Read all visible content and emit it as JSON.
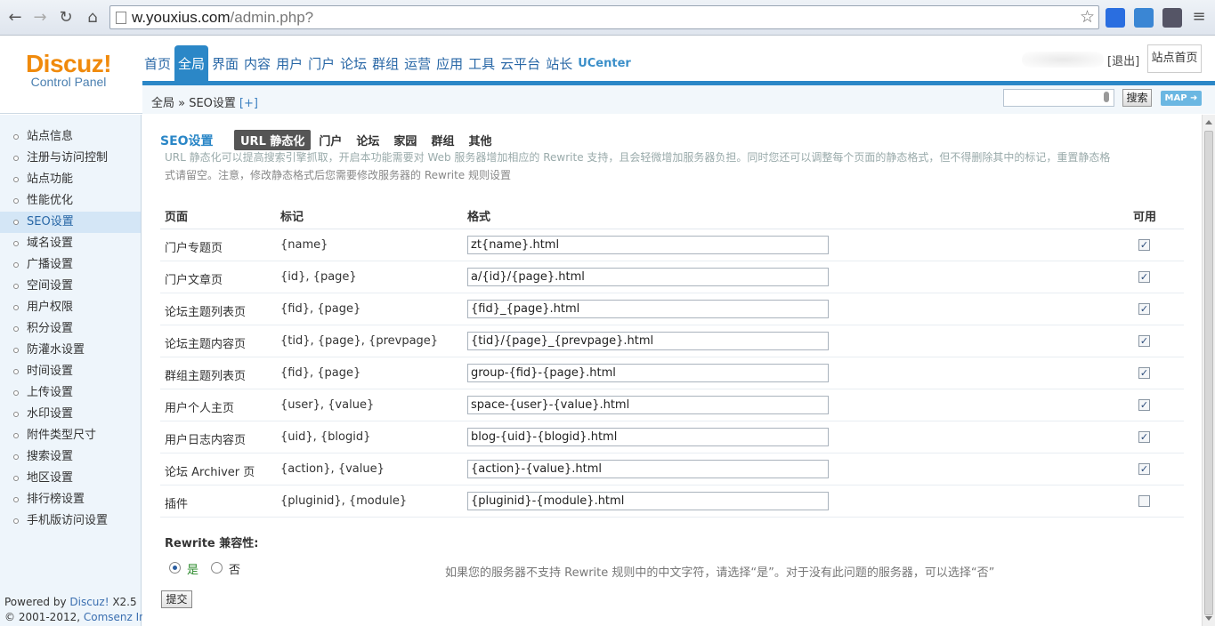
{
  "browser": {
    "url_host": "w.youxius.com",
    "url_path": "/admin.php?"
  },
  "logo": {
    "main": "Discuz!",
    "sub": "Control Panel"
  },
  "top_nav": {
    "tabs": [
      "首页",
      "全局",
      "界面",
      "内容",
      "用户",
      "门户",
      "论坛",
      "群组",
      "运营",
      "应用",
      "工具",
      "云平台",
      "站长",
      "UCenter"
    ],
    "active": "全局"
  },
  "header": {
    "logout": "[退出]",
    "site_home": "站点首页",
    "search_button": "搜索",
    "map_button": "MAP ➜"
  },
  "breadcrumb": {
    "text": "全局 » SEO设置",
    "plus": "[+]"
  },
  "sidebar": {
    "items": [
      "站点信息",
      "注册与访问控制",
      "站点功能",
      "性能优化",
      "SEO设置",
      "域名设置",
      "广播设置",
      "空间设置",
      "用户权限",
      "积分设置",
      "防灌水设置",
      "时间设置",
      "上传设置",
      "水印设置",
      "附件类型尺寸",
      "搜索设置",
      "地区设置",
      "排行榜设置",
      "手机版访问设置"
    ],
    "active": "SEO设置"
  },
  "footer": {
    "powered_prefix": "Powered by ",
    "powered_link": "Discuz!",
    "powered_version": " X2.5",
    "copyright_prefix": "© 2001-2012, ",
    "copyright_link": "Comsenz Inc."
  },
  "main": {
    "section_title": "SEO设置",
    "sub_tabs": [
      "URL 静态化",
      "门户",
      "论坛",
      "家园",
      "群组",
      "其他"
    ],
    "active_sub_tab": "URL 静态化",
    "desc_line1": "URL 静态化可以提高搜索引擎抓取，开启本功能需要对 Web 服务器增加相应的 Rewrite 支持，且会轻微增加服务器负担。同时您还可以调整每个页面的静态格式，但不得删除其中的标记，重置静态格",
    "desc_line2": "式请留空。注意，修改静态格式后您需要修改服务器的 Rewrite 规则设置",
    "table_headers": {
      "page": "页面",
      "mark": "标记",
      "format": "格式",
      "enabled": "可用"
    },
    "rows": [
      {
        "page": "门户专题页",
        "mark": "{name}",
        "format": "zt{name}.html",
        "enabled": true
      },
      {
        "page": "门户文章页",
        "mark": "{id}, {page}",
        "format": "a/{id}/{page}.html",
        "enabled": true
      },
      {
        "page": "论坛主题列表页",
        "mark": "{fid}, {page}",
        "format": "{fid}_{page}.html",
        "enabled": true
      },
      {
        "page": "论坛主题内容页",
        "mark": "{tid}, {page}, {prevpage}",
        "format": "{tid}/{page}_{prevpage}.html",
        "enabled": true
      },
      {
        "page": "群组主题列表页",
        "mark": "{fid}, {page}",
        "format": "group-{fid}-{page}.html",
        "enabled": true
      },
      {
        "page": "用户个人主页",
        "mark": "{user}, {value}",
        "format": "space-{user}-{value}.html",
        "enabled": true
      },
      {
        "page": "用户日志内容页",
        "mark": "{uid}, {blogid}",
        "format": "blog-{uid}-{blogid}.html",
        "enabled": true
      },
      {
        "page": "论坛 Archiver 页",
        "mark": "{action}, {value}",
        "format": "{action}-{value}.html",
        "enabled": true
      },
      {
        "page": "插件",
        "mark": "{pluginid}, {module}",
        "format": "{pluginid}-{module}.html",
        "enabled": false
      }
    ],
    "rewrite_label": "Rewrite 兼容性:",
    "radio_yes": "是",
    "radio_no": "否",
    "rewrite_selected": "是",
    "rewrite_tip": "如果您的服务器不支持 Rewrite 规则中的中文字符，请选择“是”。对于没有此问题的服务器，可以选择“否”",
    "submit": "提交"
  },
  "colors": {
    "accent": "#2b87c7",
    "logo_orange": "#f08a0c"
  }
}
